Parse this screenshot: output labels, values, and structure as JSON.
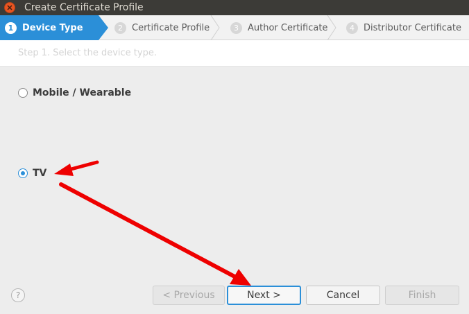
{
  "window": {
    "title": "Create Certificate Profile"
  },
  "steps": [
    {
      "num": "1",
      "label": "Device Type",
      "active": true
    },
    {
      "num": "2",
      "label": "Certificate Profile",
      "active": false
    },
    {
      "num": "3",
      "label": "Author Certificate",
      "active": false
    },
    {
      "num": "4",
      "label": "Distributor Certificate",
      "active": false
    }
  ],
  "instruction": "Step 1. Select the device type.",
  "options": [
    {
      "label": "Mobile / Wearable",
      "selected": false
    },
    {
      "label": "TV",
      "selected": true
    }
  ],
  "buttons": {
    "help": "?",
    "previous": "< Previous",
    "next": "Next >",
    "cancel": "Cancel",
    "finish": "Finish"
  },
  "colors": {
    "accent": "#2b8fd8",
    "annotation_arrow": "#ee0000",
    "titlebar": "#3c3b37",
    "close": "#e95420"
  },
  "icons": {
    "close": "close-icon",
    "help": "help-icon",
    "arrow": "arrow-annotation"
  }
}
